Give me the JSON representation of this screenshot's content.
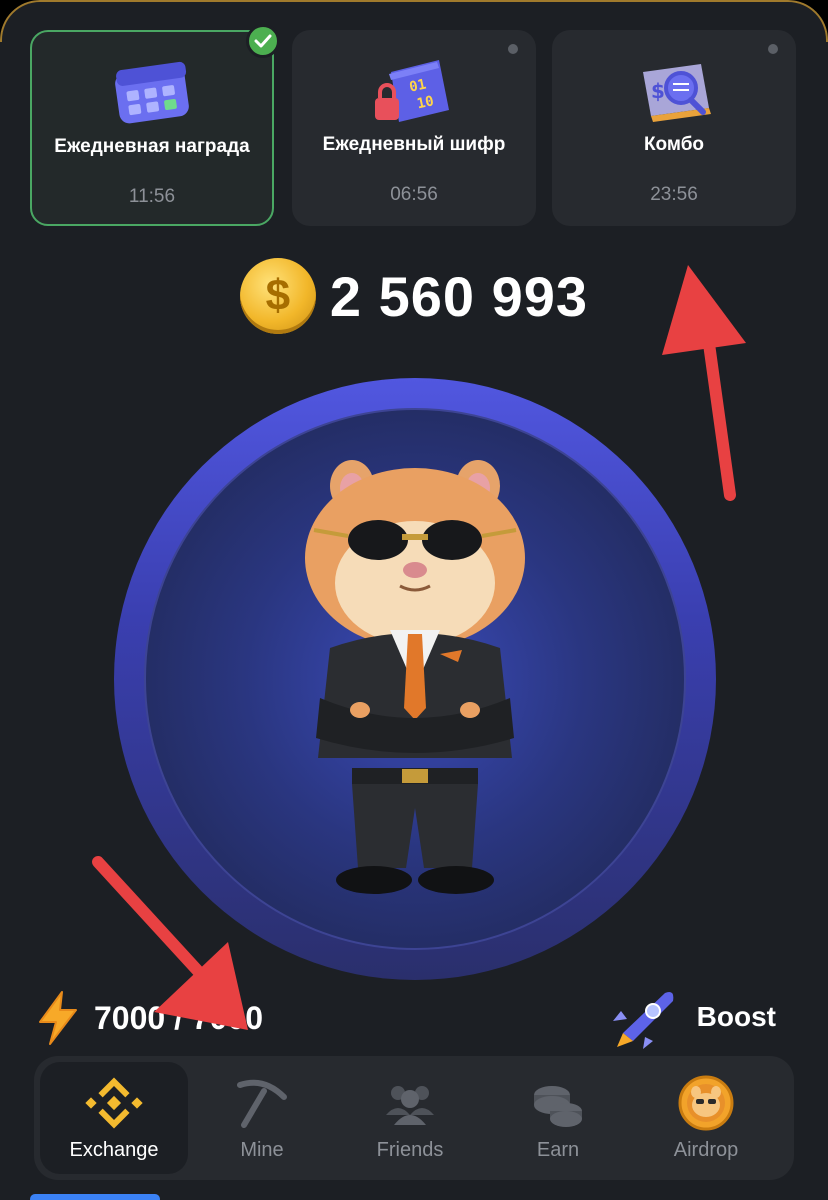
{
  "daily": [
    {
      "title": "Ежедневная награда",
      "time": "11:56",
      "done": true
    },
    {
      "title": "Ежедневный шифр",
      "time": "06:56",
      "done": false
    },
    {
      "title": "Комбо",
      "time": "23:56",
      "done": false
    }
  ],
  "balance": "2 560 993",
  "energy": "7000 / 7000",
  "boost_label": "Boost",
  "nav": [
    {
      "label": "Exchange",
      "icon": "binance-icon",
      "active": true
    },
    {
      "label": "Mine",
      "icon": "pickaxe-icon",
      "active": false
    },
    {
      "label": "Friends",
      "icon": "friends-icon",
      "active": false
    },
    {
      "label": "Earn",
      "icon": "coins-icon",
      "active": false
    },
    {
      "label": "Airdrop",
      "icon": "hamster-coin-icon",
      "active": false
    }
  ],
  "colors": {
    "background": "#1c1f24",
    "card": "#272a2f",
    "accent": "#f3ba2f",
    "arrow": "#e84142",
    "check": "#4caf50"
  }
}
